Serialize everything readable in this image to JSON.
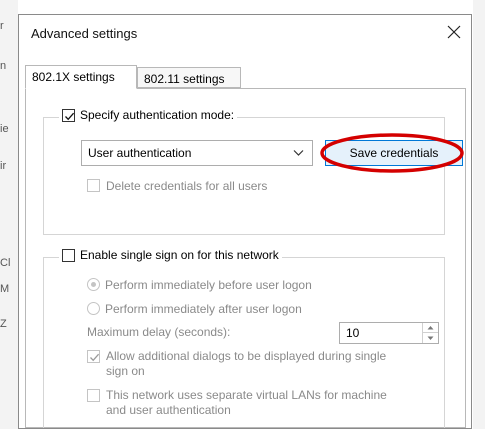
{
  "background": {
    "fragments": [
      "r",
      "n",
      "ie",
      "ir",
      "Cl",
      "M",
      "Z"
    ]
  },
  "dialog": {
    "title": "Advanced settings",
    "close_label": "✕",
    "tabs": [
      "802.1X settings",
      "802.11 settings"
    ],
    "auth_group": {
      "specify_label": "Specify authentication mode:",
      "specify_checked": true,
      "mode_selected": "User authentication",
      "save_button": "Save credentials",
      "delete_label": "Delete credentials for all users",
      "delete_checked": false
    },
    "sso_group": {
      "enable_label": "Enable single sign on for this network",
      "enable_checked": false,
      "radio_before": "Perform immediately before user logon",
      "radio_after": "Perform immediately after user logon",
      "max_delay_label": "Maximum delay (seconds):",
      "max_delay_value": "10",
      "allow_dialogs_label_line1": "Allow additional dialogs to be displayed during single",
      "allow_dialogs_label_line2": "sign on",
      "allow_dialogs_checked": true,
      "vlan_label_line1": "This network uses separate virtual LANs for machine",
      "vlan_label_line2": "and user authentication",
      "vlan_checked": false
    },
    "annotation_color": "#d40000",
    "accent_color": "#0078d7"
  }
}
